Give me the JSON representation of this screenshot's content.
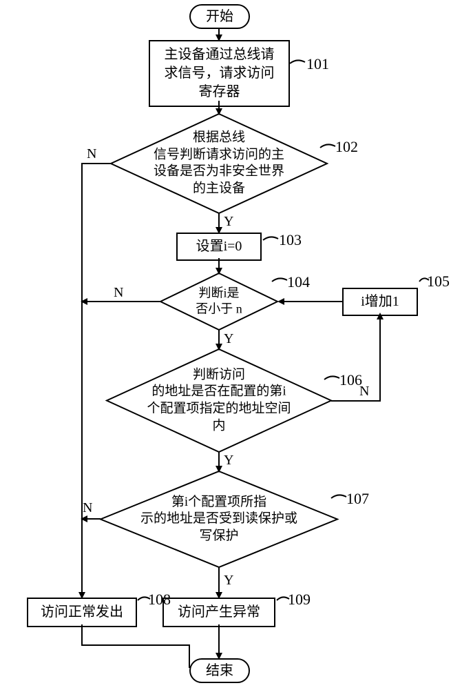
{
  "terminator": {
    "start": "开始",
    "end": "结束"
  },
  "process": {
    "p101": "主设备通过总线请\n求信号，请求访问\n寄存器",
    "p103": "设置i=0",
    "p105": "i增加1",
    "p108": "访问正常发出",
    "p109": "访问产生异常"
  },
  "decision": {
    "d102": "根据总线\n信号判断请求访问的主\n设备是否为非安全世界\n的主设备",
    "d104": "判断i是\n否小于  n",
    "d106": "判断访问\n的地址是否在配置的第i\n个配置项指定的地址空间\n内",
    "d107": "第i个配置项所指\n示的地址是否受到读保护或\n写保护"
  },
  "step_labels": {
    "l101": "101",
    "l102": "102",
    "l103": "103",
    "l104": "104",
    "l105": "105",
    "l106": "106",
    "l107": "107",
    "l108": "108",
    "l109": "109"
  },
  "branch": {
    "yes": "Y",
    "no": "N"
  }
}
